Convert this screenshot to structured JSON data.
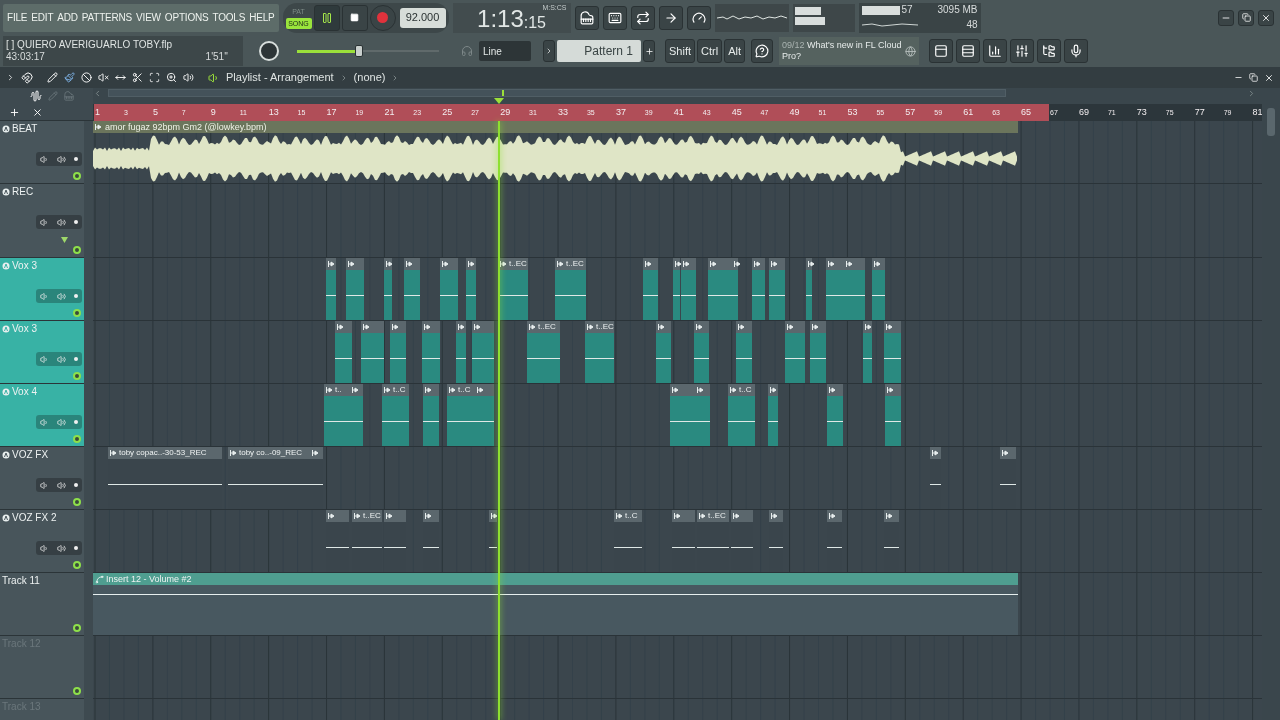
{
  "menu": [
    "FILE",
    "EDIT",
    "ADD",
    "PATTERNS",
    "VIEW",
    "OPTIONS",
    "TOOLS",
    "HELP"
  ],
  "transport": {
    "modes": [
      {
        "label": "PAT",
        "selected": false
      },
      {
        "label": "SONG",
        "selected": true
      }
    ],
    "playing": true,
    "tempo": "92.000"
  },
  "time": {
    "main": "1:13",
    "sub": ":15",
    "unit": "M:S:CS"
  },
  "monitor": {
    "cpu": "57",
    "memory": "3095 MB",
    "polyphony": "48"
  },
  "project": {
    "name": "[   ] QUIERO AVERIGUARLO TOBY.flp",
    "elapsed": "43:03:17",
    "length": "1'51''"
  },
  "master": {
    "level": 0.44
  },
  "snap": "Line",
  "pattern": "Pattern 1",
  "modifiers": [
    "Shift",
    "Ctrl",
    "Alt"
  ],
  "news": {
    "date": "09/12",
    "text": "What's new in FL Cloud Pro?"
  },
  "playlist": {
    "title": "Playlist - Arrangement",
    "arrangement": "(none)"
  },
  "ruler": [
    {
      "label": "1",
      "in_range": true
    },
    {
      "label": "3",
      "in_range": true
    },
    {
      "label": "5",
      "in_range": true
    },
    {
      "label": "7",
      "in_range": true
    },
    {
      "label": "9",
      "in_range": true
    },
    {
      "label": "11",
      "in_range": true
    },
    {
      "label": "13",
      "in_range": true
    },
    {
      "label": "15",
      "in_range": true
    },
    {
      "label": "17",
      "in_range": true
    },
    {
      "label": "19",
      "in_range": true
    },
    {
      "label": "21",
      "in_range": true
    },
    {
      "label": "23",
      "in_range": true
    },
    {
      "label": "25",
      "in_range": true
    },
    {
      "label": "27",
      "in_range": true
    },
    {
      "label": "29",
      "in_range": true
    },
    {
      "label": "31",
      "in_range": true
    },
    {
      "label": "33",
      "in_range": true
    },
    {
      "label": "35",
      "in_range": true
    },
    {
      "label": "37",
      "in_range": true
    },
    {
      "label": "39",
      "in_range": true
    },
    {
      "label": "41",
      "in_range": true
    },
    {
      "label": "43",
      "in_range": true
    },
    {
      "label": "45",
      "in_range": true
    },
    {
      "label": "47",
      "in_range": true
    },
    {
      "label": "49",
      "in_range": true
    },
    {
      "label": "51",
      "in_range": true
    },
    {
      "label": "53",
      "in_range": true
    },
    {
      "label": "55",
      "in_range": true
    },
    {
      "label": "57",
      "in_range": true
    },
    {
      "label": "59",
      "in_range": true
    },
    {
      "label": "61",
      "in_range": true
    },
    {
      "label": "63",
      "in_range": true
    },
    {
      "label": "65",
      "in_range": true
    },
    {
      "label": "67",
      "in_range": false
    },
    {
      "label": "69",
      "in_range": false
    },
    {
      "label": "71",
      "in_range": false
    },
    {
      "label": "73",
      "in_range": false
    },
    {
      "label": "75",
      "in_range": false
    },
    {
      "label": "77",
      "in_range": false
    },
    {
      "label": "79",
      "in_range": false
    },
    {
      "label": "81",
      "in_range": false
    }
  ],
  "tracks": [
    {
      "name": "BEAT",
      "color": "#48555b",
      "kind": "mixer",
      "disabled": false,
      "clips": [
        {
          "kind": "waveform",
          "color": "#6b755c",
          "label": "amor fugaz 92bpm Gm2 (@lowkey.bpm)"
        }
      ]
    },
    {
      "name": "REC",
      "color": "#48555b",
      "kind": "mixer",
      "disabled": false,
      "expanded": true
    },
    {
      "name": "Vox 3",
      "color": "#38b2a5",
      "kind": "mixer",
      "disabled": false,
      "clips": [
        {
          "kind": "audio",
          "color": "#2a8a80"
        },
        {
          "kind": "audio",
          "color": "#2a8a80"
        },
        {
          "kind": "audio",
          "color": "#2a8a80"
        },
        {
          "kind": "audio",
          "color": "#2a8a80"
        },
        {
          "kind": "audio",
          "color": "#2a8a80"
        },
        {
          "kind": "audio",
          "color": "#2a8a80"
        },
        {
          "kind": "audio",
          "color": "#2a8a80",
          "label": "t..EC"
        },
        {
          "kind": "audio",
          "color": "#2a8a80",
          "label": "t..EC"
        },
        {
          "kind": "audio",
          "color": "#2a8a80"
        },
        {
          "kind": "audio",
          "color": "#2a8a80"
        },
        {
          "kind": "audio",
          "color": "#2a8a80"
        },
        {
          "kind": "audio",
          "color": "#2a8a80"
        },
        {
          "kind": "audio",
          "color": "#2a8a80"
        },
        {
          "kind": "audio",
          "color": "#2a8a80"
        },
        {
          "kind": "audio",
          "color": "#2a8a80"
        },
        {
          "kind": "audio",
          "color": "#2a8a80"
        },
        {
          "kind": "audio",
          "color": "#2a8a80"
        },
        {
          "kind": "audio",
          "color": "#2a8a80"
        },
        {
          "kind": "audio",
          "color": "#2a8a80"
        }
      ]
    },
    {
      "name": "Vox 3",
      "color": "#38b2a5",
      "kind": "mixer",
      "disabled": false,
      "clips": [
        {
          "kind": "audio",
          "color": "#2a8a80"
        },
        {
          "kind": "audio",
          "color": "#2a8a80"
        },
        {
          "kind": "audio",
          "color": "#2a8a80"
        },
        {
          "kind": "audio",
          "color": "#2a8a80"
        },
        {
          "kind": "audio",
          "color": "#2a8a80"
        },
        {
          "kind": "audio",
          "color": "#2a8a80"
        },
        {
          "kind": "audio",
          "color": "#2a8a80",
          "label": "t..EC"
        },
        {
          "kind": "audio",
          "color": "#2a8a80",
          "label": "t..EC"
        },
        {
          "kind": "audio",
          "color": "#2a8a80"
        },
        {
          "kind": "audio",
          "color": "#2a8a80"
        },
        {
          "kind": "audio",
          "color": "#2a8a80"
        },
        {
          "kind": "audio",
          "color": "#2a8a80"
        },
        {
          "kind": "audio",
          "color": "#2a8a80"
        },
        {
          "kind": "audio",
          "color": "#2a8a80"
        },
        {
          "kind": "audio",
          "color": "#2a8a80"
        }
      ]
    },
    {
      "name": "Vox 4",
      "color": "#38b2a5",
      "kind": "mixer",
      "disabled": false,
      "clips": [
        {
          "kind": "audio",
          "color": "#2a8a80",
          "label": "t.."
        },
        {
          "kind": "audio",
          "color": "#2a8a80"
        },
        {
          "kind": "audio",
          "color": "#2a8a80",
          "label": "t..C"
        },
        {
          "kind": "audio",
          "color": "#2a8a80"
        },
        {
          "kind": "audio",
          "color": "#2a8a80",
          "label": "t..C"
        },
        {
          "kind": "audio",
          "color": "#2a8a80"
        },
        {
          "kind": "audio",
          "color": "#2a8a80"
        },
        {
          "kind": "audio",
          "color": "#2a8a80"
        },
        {
          "kind": "audio",
          "color": "#2a8a80",
          "label": "t..C"
        },
        {
          "kind": "audio",
          "color": "#2a8a80"
        },
        {
          "kind": "audio",
          "color": "#2a8a80"
        },
        {
          "kind": "audio",
          "color": "#2a8a80"
        }
      ]
    },
    {
      "name": "VOZ FX",
      "color": "#48555b",
      "kind": "mixer",
      "disabled": false,
      "clips": [
        {
          "kind": "audio",
          "color": "#3a454c",
          "label": "toby copac..-30-53_REC"
        },
        {
          "kind": "audio",
          "color": "#3a454c",
          "label": "toby co..-09_REC"
        },
        {
          "kind": "audio",
          "color": "#3a454c"
        },
        {
          "kind": "audio",
          "color": "#3a454c"
        },
        {
          "kind": "audio",
          "color": "#3a454c"
        }
      ]
    },
    {
      "name": "VOZ FX 2",
      "color": "#48555b",
      "kind": "mixer",
      "disabled": false,
      "clips": [
        {
          "kind": "audio",
          "color": "#3a454c"
        },
        {
          "kind": "audio",
          "color": "#3a454c",
          "label": "t..EC"
        },
        {
          "kind": "audio",
          "color": "#3a454c"
        },
        {
          "kind": "audio",
          "color": "#3a454c"
        },
        {
          "kind": "audio",
          "color": "#3a454c"
        },
        {
          "kind": "audio",
          "color": "#3a454c",
          "label": "t..C"
        },
        {
          "kind": "audio",
          "color": "#3a454c"
        },
        {
          "kind": "audio",
          "color": "#3a454c",
          "label": "t..EC"
        },
        {
          "kind": "audio",
          "color": "#3a454c"
        },
        {
          "kind": "audio",
          "color": "#3a454c"
        },
        {
          "kind": "audio",
          "color": "#3a454c"
        },
        {
          "kind": "audio",
          "color": "#3a454c"
        }
      ]
    },
    {
      "name": "Track 11",
      "color": "#48555b",
      "kind": "plain",
      "disabled": false,
      "clips": [
        {
          "kind": "automation",
          "color": "#4f9e90",
          "label": "Insert 12 - Volume #2"
        }
      ]
    },
    {
      "name": "Track 12",
      "color": "#48555b",
      "kind": "plain",
      "disabled": true
    },
    {
      "name": "Track 13",
      "color": "#48555b",
      "kind": "plain",
      "disabled": true
    }
  ]
}
